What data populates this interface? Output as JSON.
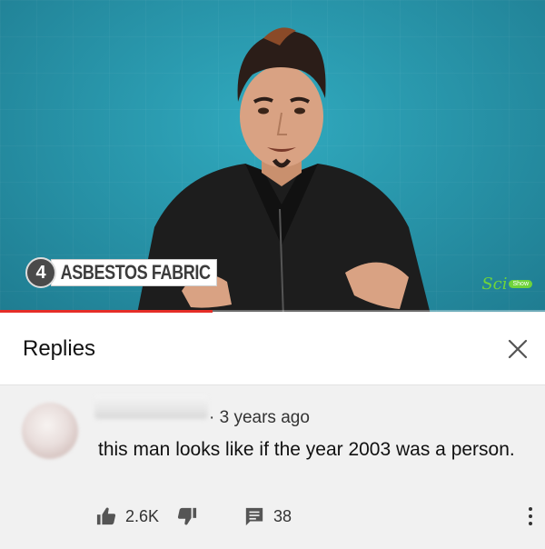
{
  "video": {
    "caption_number": "4",
    "caption_text": "ASBESTOS FABRIC",
    "logo_text": "Sci",
    "logo_tag": "Show",
    "progress": 0.39,
    "colors": {
      "background": "#2a9fb4",
      "progress": "#e52d27",
      "logo": "#6fd43a"
    }
  },
  "replies": {
    "title": "Replies",
    "close_icon": "close-icon"
  },
  "comment": {
    "age": "3 years ago",
    "text": "this man looks like if the year 2003 was a person.",
    "likes": "2.6K",
    "replies": "38",
    "icons": {
      "like": "thumbs-up-icon",
      "dislike": "thumbs-down-icon",
      "reply": "comment-icon",
      "more": "more-vertical-icon"
    }
  }
}
